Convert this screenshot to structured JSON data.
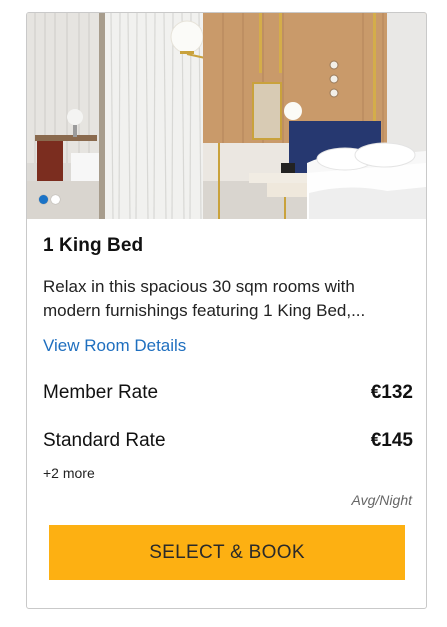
{
  "room": {
    "title": "1 King Bed",
    "description": "Relax in this spacious 30 sqm rooms with modern furnishings featuring 1 King Bed,...",
    "details_link": "View Room Details"
  },
  "carousel": {
    "total_images": 2,
    "active_index": 0
  },
  "rates": [
    {
      "label": "Member Rate",
      "price": "€132"
    },
    {
      "label": "Standard Rate",
      "price": "€145"
    }
  ],
  "more_rates": "+2 more",
  "price_unit": "Avg/Night",
  "cta": {
    "label": "SELECT & BOOK"
  },
  "colors": {
    "link": "#1f6fbf",
    "cta_background": "#fdb012",
    "active_dot": "#1a73c7"
  }
}
